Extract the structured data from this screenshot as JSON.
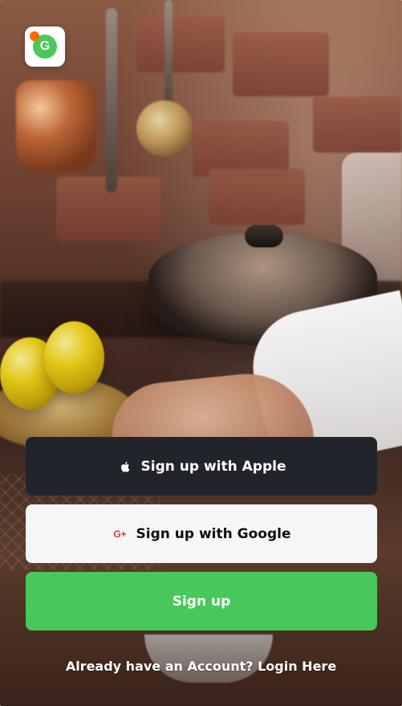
{
  "logo": {
    "letter": "G",
    "accent_dot_color": "#ff6a00",
    "badge_color": "#4cc85a"
  },
  "buttons": {
    "apple": {
      "label": "Sign up with Apple",
      "icon": "apple-icon",
      "bg": "#21252b",
      "text_color": "#ffffff"
    },
    "google": {
      "label": "Sign up with Google",
      "icon": "google-plus-icon",
      "icon_text": "G+",
      "bg": "#f6f6f8",
      "text_color": "#111111",
      "icon_color": "#d23a3a"
    },
    "signup": {
      "label": "Sign up",
      "bg": "#48c85a",
      "text_color": "#ffffff"
    }
  },
  "footer": {
    "login_text": "Already have an Account? Login Here"
  }
}
